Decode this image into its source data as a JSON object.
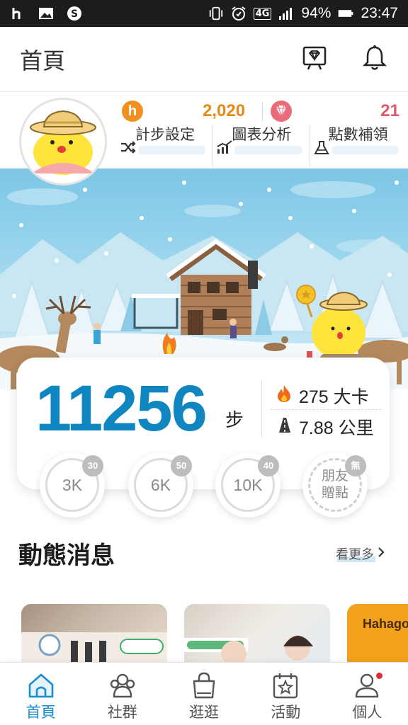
{
  "status_bar": {
    "battery": "94%",
    "time": "23:47",
    "network": "4G",
    "icons": [
      "h-icon",
      "image-icon",
      "s-icon",
      "vibrate-icon",
      "alarm-icon",
      "signal-icon",
      "battery-icon"
    ]
  },
  "header": {
    "title": "首頁",
    "icons": [
      "diamond-board-icon",
      "bell-icon"
    ]
  },
  "profile": {
    "coin_icon_letter": "h",
    "coin_points": "2,020",
    "gem_points": "21",
    "tools": [
      {
        "label": "計步設定",
        "icon": "shuffle-icon"
      },
      {
        "label": "圖表分析",
        "icon": "chart-icon"
      },
      {
        "label": "點數補領",
        "icon": "flask-icon"
      }
    ]
  },
  "steps": {
    "count": "11256",
    "unit": "步",
    "calories": "275 大卡",
    "distance": "7.88 公里"
  },
  "milestones": [
    {
      "label": "3K",
      "badge": "30"
    },
    {
      "label": "6K",
      "badge": "50"
    },
    {
      "label": "10K",
      "badge": "40"
    },
    {
      "label_line1": "朋友",
      "label_line2": "贈點",
      "badge": "無"
    }
  ],
  "news": {
    "title": "動態消息",
    "see_more": "看更多",
    "card3_brand": "Hahago"
  },
  "tabs": [
    {
      "label": "首頁",
      "icon": "home-icon",
      "active": true
    },
    {
      "label": "社群",
      "icon": "community-icon"
    },
    {
      "label": "逛逛",
      "icon": "shopping-bag-icon"
    },
    {
      "label": "活動",
      "icon": "calendar-star-icon"
    },
    {
      "label": "個人",
      "icon": "person-icon"
    }
  ],
  "colors": {
    "accent": "#0f86bf",
    "coin": "#e68a16",
    "gem": "#e0586b",
    "tab_active": "#1b8ccc"
  }
}
